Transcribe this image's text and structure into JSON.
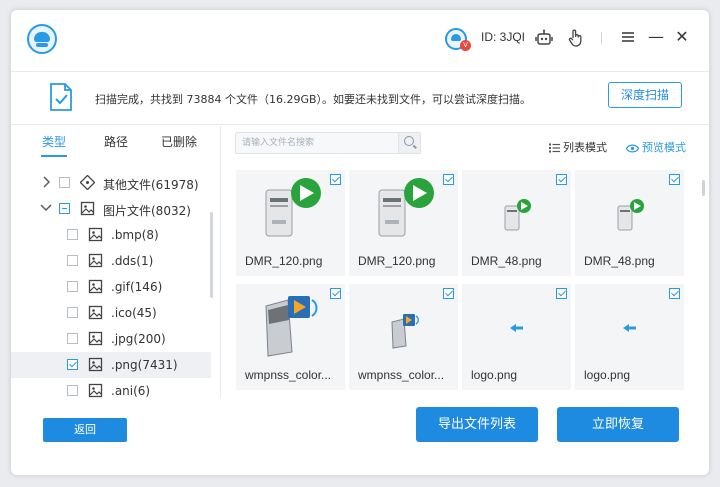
{
  "header": {
    "user_id": "ID: 3JQI",
    "vip_badge": "V",
    "minimize": "—",
    "close": "✕"
  },
  "notice": {
    "text": "扫描完成，共找到 73884 个文件（16.29GB）。如要还未找到文件，可以尝试深度扫描。",
    "deep_scan_label": "深度扫描"
  },
  "tabs": [
    {
      "label": "类型"
    },
    {
      "label": "路径"
    },
    {
      "label": "已删除"
    }
  ],
  "tree": [
    {
      "label": "其他文件(61978)"
    },
    {
      "label": "图片文件(8032)"
    },
    {
      "label": ".bmp(8)"
    },
    {
      "label": ".dds(1)"
    },
    {
      "label": ".gif(146)"
    },
    {
      "label": ".ico(45)"
    },
    {
      "label": ".jpg(200)"
    },
    {
      "label": ".png(7431)"
    },
    {
      "label": ".ani(6)"
    }
  ],
  "search": {
    "placeholder": "请输入文件名搜索"
  },
  "view": {
    "list_label": "列表模式",
    "preview_label": "预览模式"
  },
  "files": [
    {
      "name": "DMR_120.png",
      "icon": "media-server-large-icon"
    },
    {
      "name": "DMR_120.png",
      "icon": "media-server-large-icon"
    },
    {
      "name": "DMR_48.png",
      "icon": "media-server-small-icon"
    },
    {
      "name": "DMR_48.png",
      "icon": "media-server-small-icon"
    },
    {
      "name": "wmpnss_color...",
      "icon": "wmp-server-large-icon"
    },
    {
      "name": "wmpnss_color...",
      "icon": "wmp-server-small-icon"
    },
    {
      "name": "logo.png",
      "icon": "arrow-left-icon"
    },
    {
      "name": "logo.png",
      "icon": "arrow-left-icon"
    }
  ],
  "footer": {
    "back_label": "返回",
    "export_label": "导出文件列表",
    "recover_label": "立即恢复"
  },
  "colors": {
    "accent": "#1f8be0",
    "play_green": "#29a33b"
  }
}
